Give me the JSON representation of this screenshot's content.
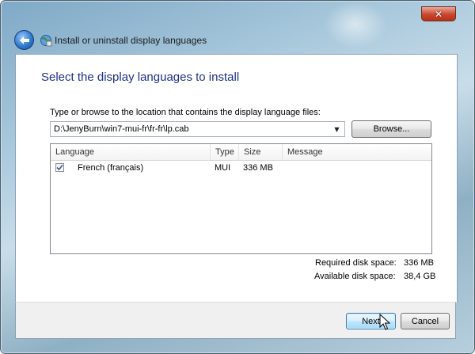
{
  "window": {
    "title": "Install or uninstall display languages",
    "close_symbol": "✕"
  },
  "main": {
    "heading": "Select the display languages to install",
    "path_label": "Type or browse to the location that contains the display language files:",
    "path_value": "D:\\JenyBurn\\win7-mui-fr\\fr-fr\\lp.cab",
    "browse_label": "Browse...",
    "list": {
      "columns": [
        "Language",
        "Type",
        "Size",
        "Message"
      ],
      "rows": [
        {
          "checked": true,
          "language": "French (français)",
          "type": "MUI",
          "size": "336 MB",
          "message": ""
        }
      ]
    },
    "disk": {
      "required_label": "Required disk space:",
      "required_value": "336 MB",
      "available_label": "Available disk space:",
      "available_value": "38,4 GB"
    }
  },
  "footer": {
    "next_label": "Next",
    "cancel_label": "Cancel"
  },
  "icons": {
    "back": "back-arrow-icon",
    "title": "language-globe-icon",
    "dropdown": "chevron-down-icon",
    "check": "checkmark-icon",
    "cursor": "mouse-pointer-icon"
  }
}
